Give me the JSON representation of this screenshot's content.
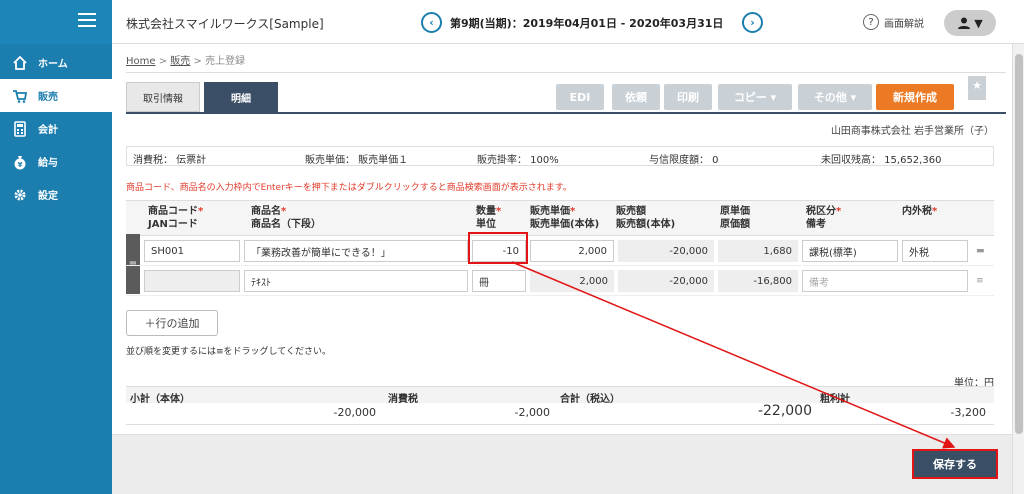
{
  "sidebar": {
    "items": [
      {
        "label": "ホーム",
        "icon": "home-icon"
      },
      {
        "label": "販売",
        "icon": "cart-icon"
      },
      {
        "label": "会計",
        "icon": "calculator-icon"
      },
      {
        "label": "給与",
        "icon": "money-bag-icon"
      },
      {
        "label": "設定",
        "icon": "gear-icon"
      }
    ]
  },
  "header": {
    "company": "株式会社スマイルワークス[Sample]",
    "period": "第9期(当期)：2019年04月01日 - 2020年03月31日",
    "help_label": "画面解説",
    "help_icon": "?"
  },
  "breadcrumb": {
    "home": "Home",
    "sales": "販売",
    "current": "売上登録",
    "sep": ">"
  },
  "tabs": {
    "info": "取引情報",
    "detail": "明細"
  },
  "toolbar": {
    "edi": "EDI",
    "request": "依頼",
    "print": "印刷",
    "copy": "コピー ▾",
    "other": "その他 ▾",
    "new": "新規作成"
  },
  "client": "山田商事株式会社 岩手営業所（子）",
  "infobar": {
    "tax": "消費税： 伝票計",
    "unit_price": "販売単価： 販売単価１",
    "rate": "販売掛率： 100%",
    "credit": "与信限度額： 0",
    "uncollected": "未回収残高： 15,652,360"
  },
  "notice": "商品コード、商品名の入力枠内でEnterキーを押下またはダブルクリックすると商品検索画面が表示されます。",
  "columns": {
    "code": "商品コード",
    "jan": "JANコード",
    "name": "商品名",
    "name2": "商品名（下段）",
    "qty": "数量",
    "unit": "単位",
    "price": "販売単価",
    "price2": "販売単価(本体)",
    "amount": "販売額",
    "amount2": "販売額(本体)",
    "cost": "原単価",
    "cost2": "原価額",
    "taxcat": "税区分",
    "memo": "備考",
    "taxinc": "内外税",
    "req": "*"
  },
  "rows": [
    {
      "code": "SH001",
      "name": "「業務改善が簡単にできる！」",
      "qty": "-10",
      "price": "2,000",
      "amount": "-20,000",
      "cost": "1,680",
      "taxcat": "課税(標準)",
      "taxinc": "外税"
    },
    {
      "jan": "",
      "name2": "ﾃｷｽﾄ",
      "unit": "冊",
      "price2": "2,000",
      "amount2": "-20,000",
      "cost2": "-16,800",
      "memo_placeholder": "備考"
    }
  ],
  "add_row": "＋行の追加",
  "drag_note": "並び順を変更するには≡をドラッグしてください。",
  "unit_label": "単位：円",
  "totals": {
    "subtotal_label": "小計（本体）",
    "subtotal": "-20,000",
    "tax_label": "消費税",
    "tax": "-2,000",
    "total_label": "合計（税込）",
    "total": "-22,000",
    "gross_label": "粗利計",
    "gross": "-3,200"
  },
  "save_label": "保存する",
  "colors": {
    "primary": "#1b7eaf",
    "dark": "#3a4f66",
    "accent": "#ec7a24",
    "highlight": "#e21414"
  }
}
